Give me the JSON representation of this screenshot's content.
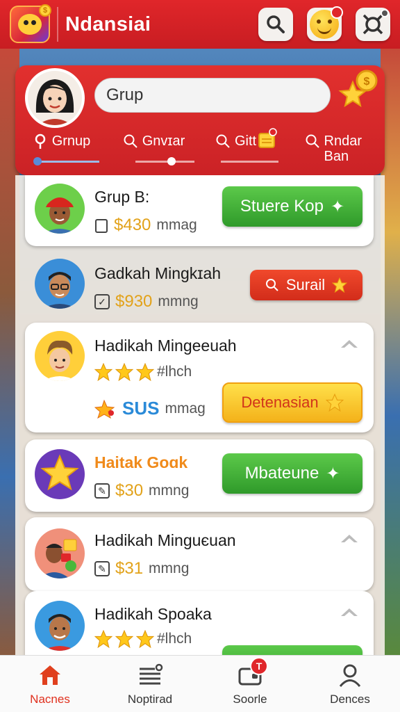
{
  "app": {
    "title": "Ndansiai"
  },
  "header": {
    "search_value": "Grup",
    "filters": [
      {
        "label": "Grnup"
      },
      {
        "label": "Gnvɪar"
      },
      {
        "label": "Gitt"
      },
      {
        "label": "Rndar Ban"
      }
    ]
  },
  "list": [
    {
      "name": "Grup B:",
      "meta_amount": "$430",
      "meta_unit": "mmag",
      "button": "Stuere Kop"
    },
    {
      "name": "Gadkah Mingkɪah",
      "meta_amount": "$930",
      "meta_unit": "mmng",
      "button": "Surail"
    },
    {
      "name": "Hadikah Mingeeuah",
      "rating_text": "#lhch",
      "meta_amount": "SUS",
      "meta_unit": "mmag",
      "button": "Detenasian"
    },
    {
      "name": "Haitak Goɑk",
      "meta_amount": "$30",
      "meta_unit": "mmng",
      "button": "Mbateune"
    },
    {
      "name": "Hadikah Minguєuan",
      "meta_amount": "$31",
      "meta_unit": "mmng"
    },
    {
      "name": "Hadikah Spoaka",
      "rating_text": "#lhch"
    }
  ],
  "bottom_nav": [
    {
      "label": "Nacnes"
    },
    {
      "label": "Noptirad"
    },
    {
      "label": "Soorle",
      "badge": "T"
    },
    {
      "label": "Dences"
    }
  ],
  "colors": {
    "brand_red": "#e0262a",
    "green": "#2f9a2a",
    "yellow": "#f4b21a",
    "gold": "#e2a21a"
  }
}
